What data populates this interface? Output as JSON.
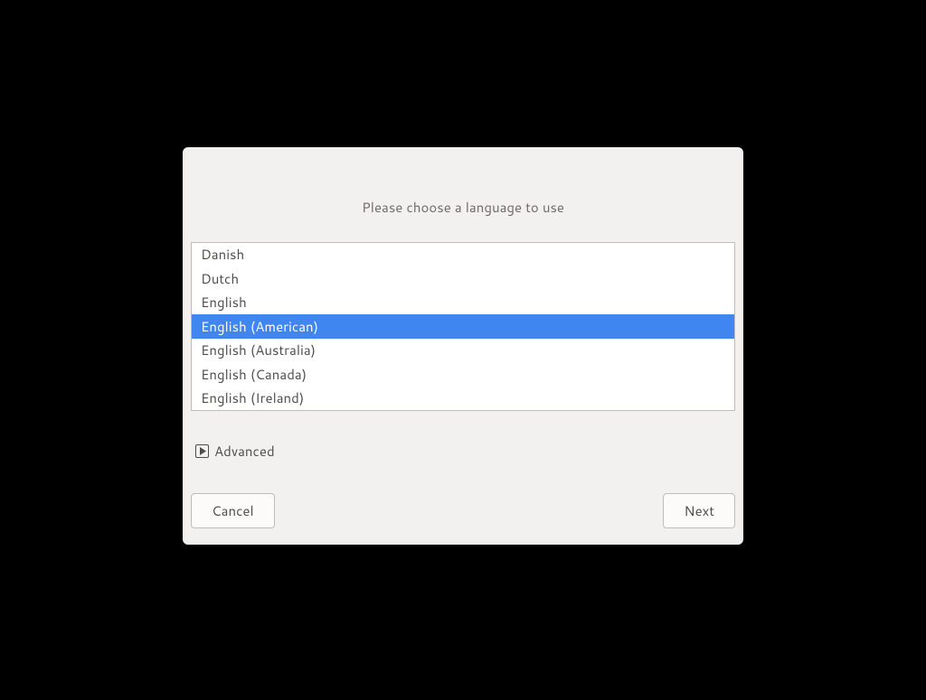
{
  "dialog": {
    "title": "Please choose a language to use",
    "languages": [
      {
        "label": "Danish",
        "selected": false
      },
      {
        "label": "Dutch",
        "selected": false
      },
      {
        "label": "English",
        "selected": false
      },
      {
        "label": "English (American)",
        "selected": true
      },
      {
        "label": "English (Australia)",
        "selected": false
      },
      {
        "label": "English (Canada)",
        "selected": false
      },
      {
        "label": "English (Ireland)",
        "selected": false
      }
    ],
    "advanced_label": "Advanced",
    "cancel_label": "Cancel",
    "next_label": "Next"
  }
}
